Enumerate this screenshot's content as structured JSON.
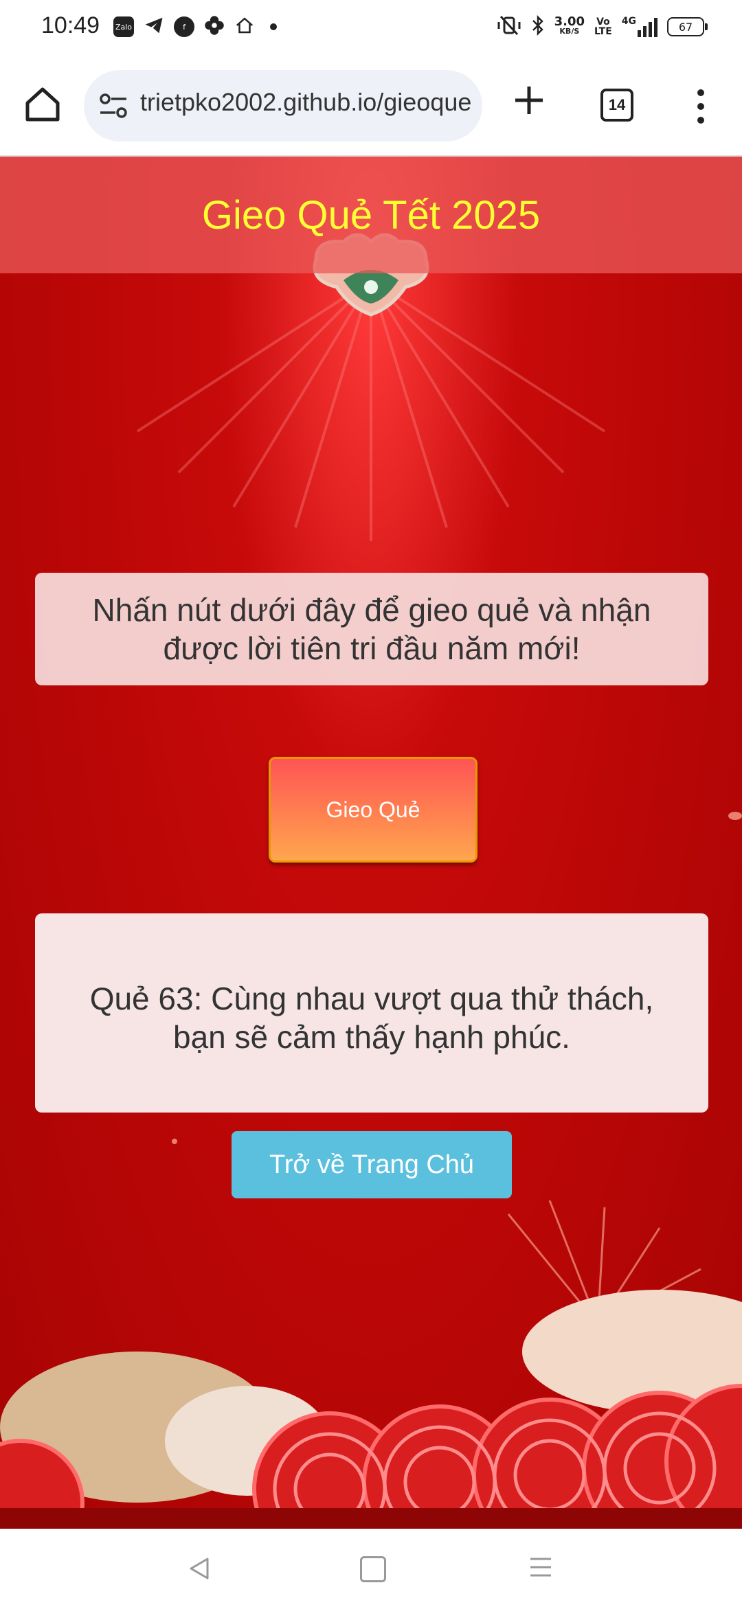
{
  "status_bar": {
    "time": "10:49",
    "icons": [
      "zalo-icon",
      "telegram-icon",
      "facebook-icon",
      "flower-icon",
      "home-wifi-icon"
    ],
    "zalo_label": "Zalo",
    "net_speed_value": "3.00",
    "net_speed_unit": "KB/S",
    "volte_top": "Vo",
    "volte_bottom": "LTE",
    "network": "4G",
    "battery": "67"
  },
  "browser": {
    "url": "trietpko2002.github.io/gieoque",
    "tab_count": "14"
  },
  "page": {
    "header_title": "Gieo Quẻ Tết 2025",
    "prompt": "Nhấn nút dưới đây để gieo quẻ và nhận được lời tiên tri đầu năm mới!",
    "gieo_button": "Gieo Quẻ",
    "result": "Quẻ 63: Cùng nhau vượt qua thử thách, bạn sẽ cảm thấy hạnh phúc.",
    "home_button": "Trở về Trang Chủ"
  },
  "colors": {
    "header_title": "#ffff33",
    "page_red": "#b90606",
    "button_gradient_top": "#ff5454",
    "button_gradient_bottom": "#ffa64d",
    "home_button": "#5bc0de"
  }
}
